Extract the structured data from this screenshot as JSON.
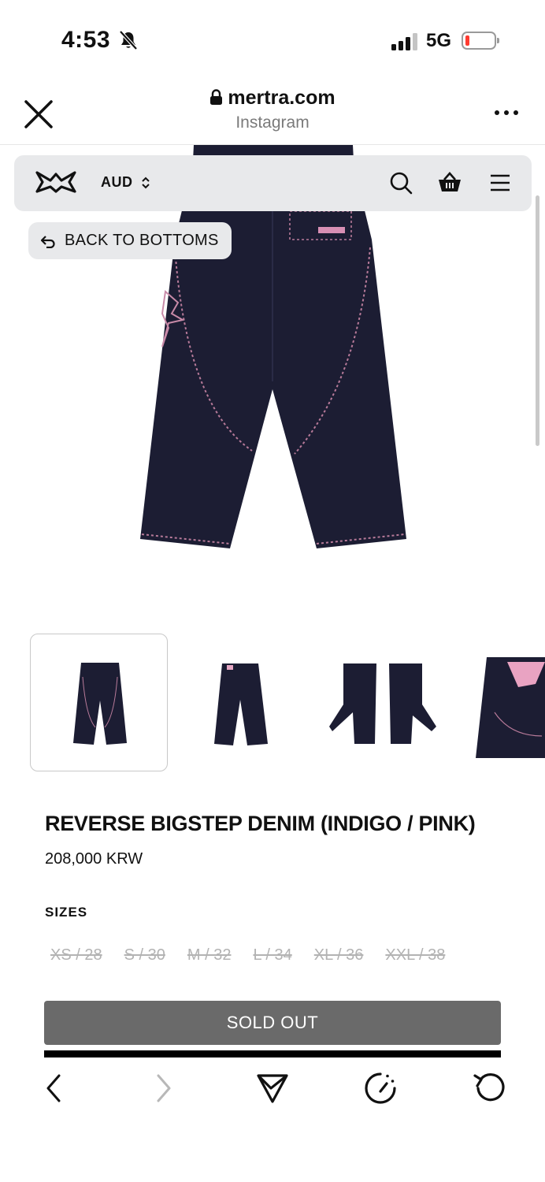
{
  "status_bar": {
    "time": "4:53",
    "network": "5G",
    "battery_level": 0.1,
    "signal_bars": 3,
    "icons": [
      "bell-slash-icon",
      "signal-icon",
      "battery-icon"
    ]
  },
  "browser": {
    "domain": "mertra.com",
    "subtitle": "Instagram",
    "icons": [
      "close-icon",
      "lock-icon",
      "more-icon"
    ]
  },
  "site_nav": {
    "currency": "AUD",
    "icons": [
      "logo",
      "chevron-updown-icon",
      "search-icon",
      "basket-icon",
      "menu-icon"
    ]
  },
  "back_button": {
    "label": "BACK TO BOTTOMS",
    "icon": "return-arrow-icon"
  },
  "product": {
    "title": "REVERSE BIGSTEP DENIM (INDIGO / PINK)",
    "price": "208,000 KRW",
    "sizes_label": "SIZES",
    "sizes": [
      "XS / 28",
      "S / 30",
      "M / 32",
      "L / 34",
      "XL / 36",
      "XXL / 38"
    ],
    "sold_out_label": "SOLD OUT",
    "thumbnails": [
      "front",
      "back",
      "side",
      "pocket-detail"
    ]
  },
  "colors": {
    "denim": "#1c1d33",
    "stitch": "#c88aa8",
    "sold_out_bg": "#6a6a6a",
    "nav_bg": "#e8e9eb",
    "size_disabled": "#b3b3b3"
  },
  "toolbar": {
    "icons": [
      "back-arrow-icon",
      "forward-arrow-icon",
      "share-icon",
      "speedometer-icon",
      "reload-icon"
    ]
  }
}
